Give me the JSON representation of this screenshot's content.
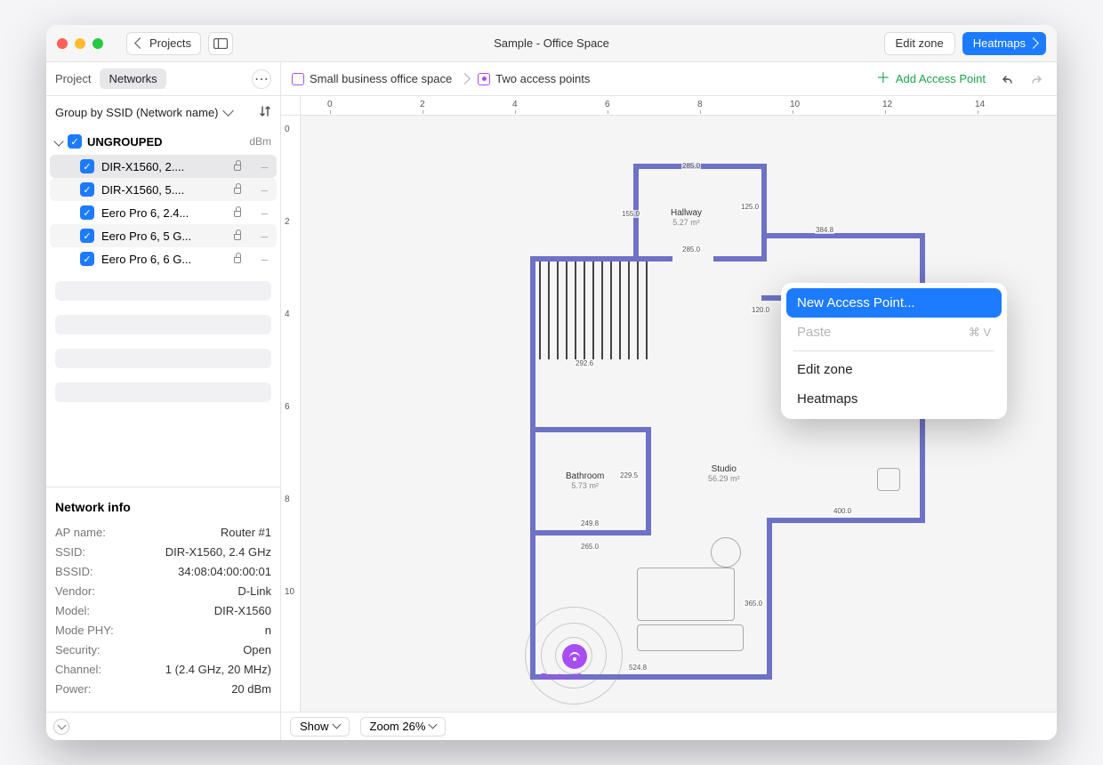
{
  "titlebar": {
    "back_label": "Projects",
    "title": "Sample - Office Space",
    "edit_zone": "Edit zone",
    "heatmaps": "Heatmaps"
  },
  "sidebar": {
    "tab_project": "Project",
    "tab_networks": "Networks",
    "group_by": "Group by SSID (Network name)",
    "group_title": "UNGROUPED",
    "group_unit": "dBm",
    "networks": [
      {
        "name": "DIR-X1560, 2....",
        "dbm": "–",
        "selected": true
      },
      {
        "name": "DIR-X1560, 5....",
        "dbm": "–",
        "selected": false
      },
      {
        "name": "Eero Pro 6, 2.4...",
        "dbm": "–",
        "selected": false
      },
      {
        "name": "Eero Pro 6, 5 G...",
        "dbm": "–",
        "selected": false
      },
      {
        "name": "Eero Pro 6, 6 G...",
        "dbm": "–",
        "selected": false
      }
    ],
    "info_title": "Network info",
    "info": {
      "ap_name_k": "AP name:",
      "ap_name_v": "Router #1",
      "ssid_k": "SSID:",
      "ssid_v": "DIR-X1560, 2.4 GHz",
      "bssid_k": "BSSID:",
      "bssid_v": "34:08:04:00:00:01",
      "vendor_k": "Vendor:",
      "vendor_v": "D-Link",
      "model_k": "Model:",
      "model_v": "DIR-X1560",
      "mode_k": "Mode PHY:",
      "mode_v": "n",
      "security_k": "Security:",
      "security_v": "Open",
      "channel_k": "Channel:",
      "channel_v": "1 (2.4 GHz, 20 MHz)",
      "power_k": "Power:",
      "power_v": "20 dBm"
    }
  },
  "breadcrumb": {
    "seg1": "Small business office space",
    "seg2": "Two access points",
    "add_ap": "Add Access Point"
  },
  "ruler_h": [
    "0",
    "2",
    "4",
    "6",
    "8",
    "10",
    "12",
    "14"
  ],
  "ruler_v": [
    "0",
    "2",
    "4",
    "6",
    "8",
    "10"
  ],
  "floorplan": {
    "rooms": {
      "hallway": {
        "name": "Hallway",
        "area": "5.27 m²"
      },
      "bathroom": {
        "name": "Bathroom",
        "area": "5.73 m²"
      },
      "studio": {
        "name": "Studio",
        "area": "56.29 m²"
      }
    },
    "dims": {
      "d1": "285.0",
      "d2": "155.0",
      "d3": "125.0",
      "d4": "384.8",
      "d5": "292.6",
      "d6": "120.0",
      "d7": "229.5",
      "d8": "249.8",
      "d9": "265.0",
      "d10": "524.8",
      "d11": "400.0",
      "d12": "365.0",
      "d13": "285.0"
    },
    "router_label": "Router #2"
  },
  "contextmenu": {
    "new_ap": "New Access Point...",
    "paste": "Paste",
    "paste_shortcut": "⌘ V",
    "edit_zone": "Edit zone",
    "heatmaps": "Heatmaps"
  },
  "statusbar": {
    "show": "Show",
    "zoom": "Zoom 26%"
  }
}
